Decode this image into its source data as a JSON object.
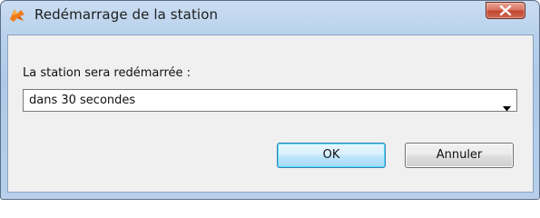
{
  "window": {
    "title": "Redémarrage de la station",
    "icon": "avast-logo-icon",
    "close_icon": "close-icon"
  },
  "dialog": {
    "prompt_label": "La station sera redémarrée :",
    "restart_delay": {
      "selected": "dans 30 secondes",
      "arrow_icon": "dropdown-arrow-icon"
    },
    "ok_label": "OK",
    "cancel_label": "Annuler"
  },
  "colors": {
    "titlebar": "#b9d1ec",
    "client_bg": "#f0f0f0",
    "close_button": "#c2462e",
    "ok_border": "#3c7fb1"
  }
}
